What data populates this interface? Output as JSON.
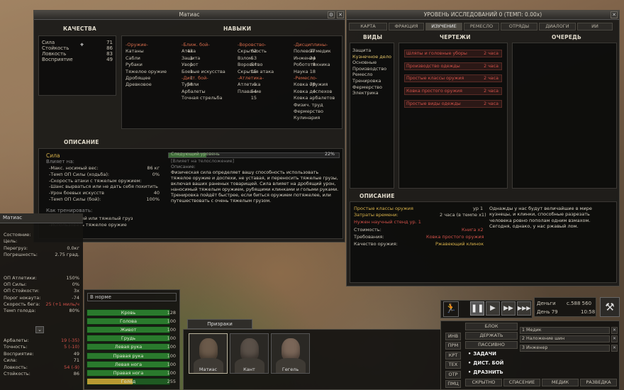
{
  "char_window": {
    "title": "Матиас",
    "qualities_header": "КАЧЕСТВА",
    "skills_header": "НАВЫКИ",
    "description_header": "ОПИСАНИЕ",
    "attributes": [
      {
        "name": "Сила",
        "value": "71"
      },
      {
        "name": "Стойкость",
        "value": "86"
      },
      {
        "name": "Ловкость",
        "value": "83"
      },
      {
        "name": "Восприятие",
        "value": "49"
      }
    ],
    "col1": [
      {
        "name": "-Оружие-",
        "value": "",
        "cat": true
      },
      {
        "name": "Катаны",
        "value": "43"
      },
      {
        "name": "Сабли",
        "value": "1"
      },
      {
        "name": "Рубаки",
        "value": "1"
      },
      {
        "name": "Тяжелое оружие",
        "value": "1"
      },
      {
        "name": "Дробящее",
        "value": "1"
      },
      {
        "name": "Древковое",
        "value": "58"
      }
    ],
    "col2": [
      {
        "name": "-Ближ. бой-",
        "value": "",
        "cat": true
      },
      {
        "name": "Атака",
        "value": "62"
      },
      {
        "name": "Защита",
        "value": "53"
      },
      {
        "name": "Уворот",
        "value": "54"
      },
      {
        "name": "Боевые искусства",
        "value": "15"
      },
      {
        "name": "-Дист. бой-",
        "value": "",
        "cat": true
      },
      {
        "name": "Турели",
        "value": "1"
      },
      {
        "name": "Арбалеты",
        "value": "54"
      },
      {
        "name": "Точная стрельба",
        "value": "15"
      }
    ],
    "col3": [
      {
        "name": "-Воровство-",
        "value": "",
        "cat": true
      },
      {
        "name": "Скрытность",
        "value": "77"
      },
      {
        "name": "Взлом",
        "value": "24"
      },
      {
        "name": "Воровство",
        "value": "8"
      },
      {
        "name": "Скрытая атака",
        "value": "18"
      },
      {
        "name": "-Атлетика-",
        "value": "",
        "cat": true
      },
      {
        "name": "Атлетика",
        "value": "78"
      },
      {
        "name": "Плавание",
        "value": "4"
      }
    ],
    "col4": [
      {
        "name": "-Дисциплины-",
        "value": "",
        "cat": true
      },
      {
        "name": "Полевой медик",
        "value": "79"
      },
      {
        "name": "Инженер",
        "value": "21"
      },
      {
        "name": "Робототехника",
        "value": "1"
      },
      {
        "name": "Наука",
        "value": "17"
      },
      {
        "name": "-Ремесло-",
        "value": "",
        "cat": true
      },
      {
        "name": "Ковка оружия",
        "value": "1"
      },
      {
        "name": "Ковка доспехов",
        "value": "1"
      },
      {
        "name": "Ковка арбалетов",
        "value": "1"
      },
      {
        "name": "Физич. труд",
        "value": "64"
      },
      {
        "name": "Фермерство",
        "value": "1"
      },
      {
        "name": "Кулинария",
        "value": "1"
      }
    ],
    "desc": {
      "title": "Сила",
      "affects_label": "Влияет на:",
      "effects": [
        {
          "name": "-Макс. носимый вес:",
          "value": "86 кг"
        },
        {
          "name": "-Темп ОП Силы (ходьба):",
          "value": "0%"
        },
        {
          "name": "-Скорость атаки с тяжелым оружием:",
          "value": ""
        },
        {
          "name": "-Шанс вырваться или не дать себя похитить",
          "value": ""
        },
        {
          "name": "-Урон боевых искусств",
          "value": "40"
        },
        {
          "name": "-Темп ОП Силы (бой):",
          "value": "100%"
        }
      ],
      "howto_label": "Как тренировать:",
      "howto": [
        "-Таскать людей или тяжелый груз",
        "-Использовать тяжелое оружие"
      ],
      "next_level": "Следующий уровень",
      "next_pct": "22%",
      "next_pct_num": 22,
      "body_note": "[Влияет на телосложение]",
      "desc_label": "Описание:",
      "text": "Физическая сила определяет вашу способность использовать тяжелое оружие и доспехи, не уставая, и переносить тяжелые грузы, включая ваших раненых товарищей. Сила влияет на дробящий урон, наносимый тяжелым оружием, рубящими клинками и голыми руками. Тренировка пойдёт быстрее, если биться оружием потяжелее, или путешествовать с очень тяжелым грузом."
    }
  },
  "research_window": {
    "title": "УРОВЕНЬ ИССЛЕДОВАНИЙ 0 (ТЕМП: 0.00x)",
    "tabs": [
      "КАРТА",
      "ФРАКЦИЯ",
      "ИЗУЧЕНИЕ",
      "РЕМЕСЛО",
      "ОТРЯДЫ",
      "ДИАЛОГИ",
      "ИИ"
    ],
    "active_tab": "ИЗУЧЕНИЕ",
    "types_header": "ВИДЫ",
    "blueprints_header": "ЧЕРТЕЖИ",
    "queue_header": "ОЧЕРЕДЬ",
    "types": [
      "Защита",
      "Кузнечное дело",
      "Основные",
      "Производство",
      "Ремесло",
      "Тренировка",
      "Фермерство",
      "Электрика"
    ],
    "active_type": "Кузнечное дело",
    "blueprints": [
      {
        "name": "Шляпы и головные уборы",
        "time": "2 часа"
      },
      {
        "name": "Производство одежды",
        "time": "2 часа"
      },
      {
        "name": "Простые классы оружия",
        "time": "2 часа"
      },
      {
        "name": "Ковка простого оружия",
        "time": "2 часа"
      },
      {
        "name": "Простые виды одежды",
        "time": "2 часа"
      }
    ],
    "desc_header": "ОПИСАНИЕ",
    "selected_name": "Простые классы оружия",
    "selected_level": "ур 1",
    "time_label": "Затраты времени:",
    "time_value": "2 часа (в темпе x1)",
    "requires_bench": "Нужен научный стенд ур. 1",
    "cost_label": "Стоимость:",
    "cost_value": "Книга x2",
    "req_label": "Требования:",
    "req_value": "Ковка простого оружия",
    "quality_label": "Качество оружия:",
    "quality_value": "Ржавеющий клинок",
    "flavor": "Однажды у нас будут величайшие в мире кузнецы, и клинки, способные разрезать человека ровно пополам одним взмахом. Сегодня, однако, у нас ржавый лом."
  },
  "left_status": {
    "name": "Матиас",
    "stats": [
      {
        "name": "Состояние:",
        "value": "",
        "color": ""
      },
      {
        "name": "Цель:",
        "value": "",
        "color": ""
      },
      {
        "name": "Перегруз:",
        "value": "0.0кг",
        "color": ""
      },
      {
        "name": "Погрешность:",
        "value": "2.75 град.",
        "color": ""
      }
    ],
    "rates": [
      {
        "name": "ОП Атлетики:",
        "value": "150%",
        "color": ""
      },
      {
        "name": "ОП Силы:",
        "value": "0%",
        "color": ""
      },
      {
        "name": "ОП Стойкости:",
        "value": "3x",
        "color": ""
      },
      {
        "name": "Порог нокаута:",
        "value": "-74",
        "color": ""
      },
      {
        "name": "Скорость бега:",
        "value": "25 (+1 миль/ч",
        "color": "red"
      },
      {
        "name": "Темп голода:",
        "value": "80%",
        "color": ""
      }
    ],
    "combat": [
      {
        "name": "Арбалеты:",
        "value": "19 (-35)",
        "color": "red"
      },
      {
        "name": "Точность:",
        "value": "5 (-10)",
        "color": "red"
      },
      {
        "name": "Восприятие:",
        "value": "49",
        "color": ""
      },
      {
        "name": "Сила:",
        "value": "71",
        "color": ""
      },
      {
        "name": "Ловкость:",
        "value": "54 (-9)",
        "color": "red"
      },
      {
        "name": "Стойкость:",
        "value": "86",
        "color": ""
      }
    ]
  },
  "health": {
    "status": "В норме",
    "parts": [
      {
        "name": "Кровь",
        "value": "128",
        "fill": 1.0
      },
      {
        "name": "Голова",
        "value": "100",
        "fill": 1.0
      },
      {
        "name": "Живот",
        "value": "100",
        "fill": 1.0
      },
      {
        "name": "Грудь",
        "value": "100",
        "fill": 1.0
      },
      {
        "name": "Левая рука",
        "value": "100",
        "fill": 1.0
      },
      {
        "name": "Правая рука",
        "value": "100",
        "fill": 1.0
      },
      {
        "name": "Левая нога",
        "value": "100",
        "fill": 1.0
      },
      {
        "name": "Правая нога",
        "value": "100",
        "fill": 1.0
      },
      {
        "name": "Голод",
        "value": "255",
        "fill": 0.55
      }
    ]
  },
  "squad": {
    "name": "Призраки",
    "members": [
      {
        "name": "Матиас"
      },
      {
        "name": "Кант"
      },
      {
        "name": "Гегель"
      }
    ]
  },
  "time": {
    "money_label": "Деньги",
    "money": "c.588 560",
    "day": "День 79",
    "clock": "10:58"
  },
  "sidebuttons": [
    "ИНВ",
    "ПРМ",
    "КРТ",
    "ТЕХ",
    "ОТР",
    "ПМЦ"
  ],
  "orders": [
    "БЛОК",
    "ДЕРЖАТЬ",
    "ПАССИВНО"
  ],
  "stances": [
    "ЗАДАЧИ",
    "ДИСТ. БОЙ",
    "ДРАЗНИТЬ"
  ],
  "jobs": [
    "1 Медик",
    "2 Наложение шин",
    "3 Инженер"
  ],
  "bottom_buttons": [
    "СКРЫТНО",
    "СПАСЕНИЕ",
    "МЕДИК",
    "РАЗВЕДКА"
  ]
}
